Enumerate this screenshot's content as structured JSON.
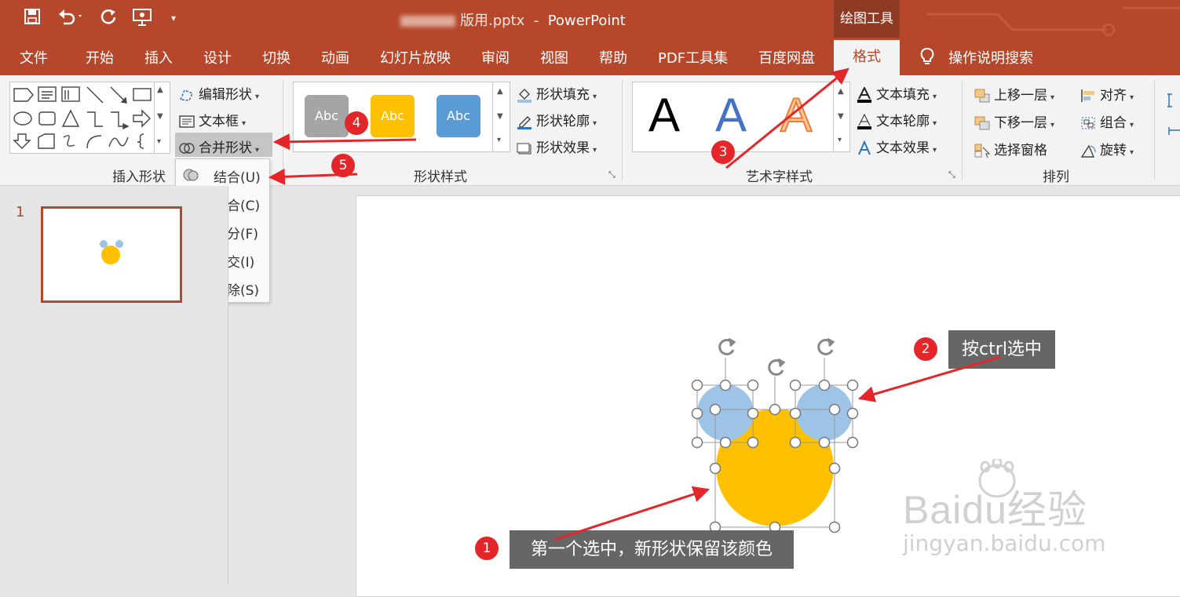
{
  "titlebar": {
    "filename_visible": "版用.pptx",
    "app_name": "PowerPoint",
    "contextual_group": "绘图工具"
  },
  "tabs": [
    "文件",
    "开始",
    "插入",
    "设计",
    "切换",
    "动画",
    "幻灯片放映",
    "审阅",
    "视图",
    "帮助",
    "PDF工具集",
    "百度网盘"
  ],
  "active_tab": "格式",
  "tell_me": "操作说明搜索",
  "ribbon": {
    "insert_shapes": {
      "label": "插入形状",
      "edit_shape": "编辑形状",
      "text_box": "文本框",
      "merge_shapes": "合并形状"
    },
    "shape_styles": {
      "label": "形状样式",
      "presets": [
        {
          "text": "Abc",
          "color": "#a5a5a5"
        },
        {
          "text": "Abc",
          "color": "#ffc000"
        },
        {
          "text": "Abc",
          "color": "#5b9bd5"
        }
      ],
      "fill": "形状填充",
      "outline": "形状轮廓",
      "effects": "形状效果"
    },
    "wordart_styles": {
      "label": "艺术字样式",
      "presets": [
        {
          "text": "A",
          "color": "#000000"
        },
        {
          "text": "A",
          "color": "#4472c4"
        },
        {
          "text": "A",
          "color": "#ed7d31"
        }
      ],
      "fill": "文本填充",
      "outline": "文本轮廓",
      "effects": "文本效果"
    },
    "arrange": {
      "label": "排列",
      "bring_forward": "上移一层",
      "send_backward": "下移一层",
      "selection_pane": "选择窗格",
      "align": "对齐",
      "group": "组合",
      "rotate": "旋转"
    }
  },
  "merge_menu": [
    {
      "label": "结合(U)",
      "name": "union"
    },
    {
      "label": "组合(C)",
      "name": "combine"
    },
    {
      "label": "拆分(F)",
      "name": "fragment"
    },
    {
      "label": "相交(I)",
      "name": "intersect"
    },
    {
      "label": "剪除(S)",
      "name": "subtract"
    }
  ],
  "slides": {
    "number": "1"
  },
  "shapes": {
    "big_circle_color": "#ffc000",
    "small_circle_color": "#9dc3e6"
  },
  "annotations": {
    "b1": "1",
    "t1": "第一个选中，新形状保留该颜色",
    "b2": "2",
    "t2": "按ctrl选中",
    "b3": "3",
    "b4": "4",
    "b5": "5"
  },
  "watermark": {
    "brand": "Baidu经验",
    "url": "jingyan.baidu.com"
  },
  "colors": {
    "accent": "#b7472a",
    "arrow": "#e4262b"
  }
}
